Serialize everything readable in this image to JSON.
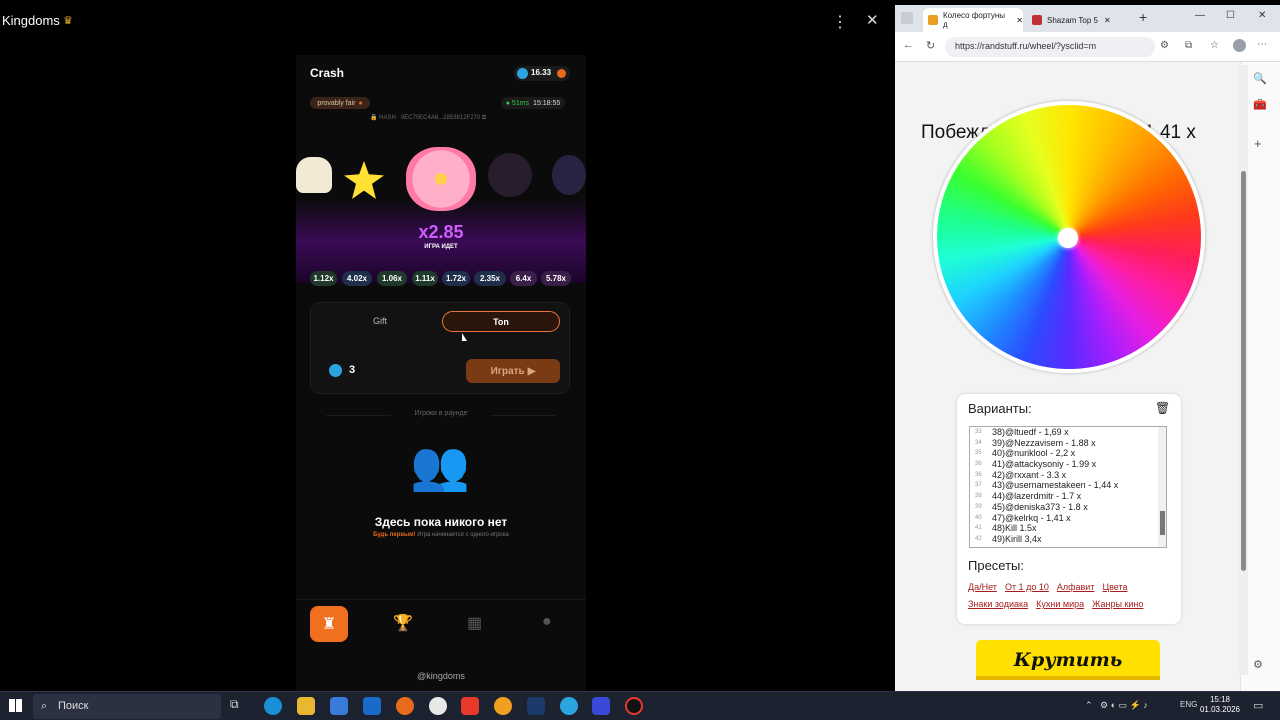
{
  "telegram": {
    "window_title": "Kingdoms",
    "crown_icon": "crown-icon"
  },
  "app": {
    "title": "Crash",
    "balance": "16.33",
    "provably_fair": "provably fair",
    "ping": "51ms",
    "time": "15:18:55",
    "hash_label": "HASH",
    "hash_value": "0EC70EC4A6...2853812F270",
    "multiplier": "x2.85",
    "status": "ИГРА ИДЕТ",
    "history": [
      "1.12x",
      "4.02x",
      "1.06x",
      "1.11x",
      "1.72x",
      "2.35x",
      "6.4x",
      "5.78x"
    ],
    "tab_gift": "Gift",
    "tab_ton": "Ton",
    "bet_amount": "3",
    "play_button": "Играть",
    "players_header": "Игроки в раунде",
    "empty_title": "Здесь пока никого нет",
    "empty_highlight": "Будь первым!",
    "empty_sub": "Игра начинается с одного игрока",
    "footer": "@kingdoms"
  },
  "browser": {
    "tabs": [
      "Колесо фортуны д",
      "Shazam Top 5"
    ],
    "url": "https://randstuff.ru/wheel/?ysclid=m",
    "winner": "Побеждает: 47)@kelrkq - 1,41 x",
    "variants_label": "Варианты:",
    "variants": [
      {
        "n": "33",
        "text": "38)@ltuedf - 1,69 x"
      },
      {
        "n": "34",
        "text": "39)@Nezzavisem - 1.88 x"
      },
      {
        "n": "35",
        "text": "40)@nuriklool - 2,2 x"
      },
      {
        "n": "36",
        "text": "41)@attackysoniy - 1.99 x"
      },
      {
        "n": "36",
        "text": "42)@rxxant - 3.3 x"
      },
      {
        "n": "37",
        "text": "43)@usernamestakeen - 1,44 x"
      },
      {
        "n": "38",
        "text": "44)@lazerdmitr - 1.7 x"
      },
      {
        "n": "39",
        "text": "45)@deniska373 - 1.8 x"
      },
      {
        "n": "40",
        "text": "47)@kelrkq - 1,41 x"
      },
      {
        "n": "41",
        "text": "48)Kill 1.5x"
      },
      {
        "n": "42",
        "text": "49)Kirill 3,4x"
      }
    ],
    "presets_label": "Пресеты:",
    "presets_row1": [
      "Да/Нет",
      "От 1 до 10",
      "Алфавит",
      "Цвета"
    ],
    "presets_row2": [
      "Знаки зодиака",
      "Кухни мира",
      "Жанры кино"
    ],
    "spin_button": "Крутить"
  },
  "taskbar": {
    "search": "Поиск",
    "lang": "ENG",
    "time": "15:18",
    "date": "01.03.2026"
  }
}
